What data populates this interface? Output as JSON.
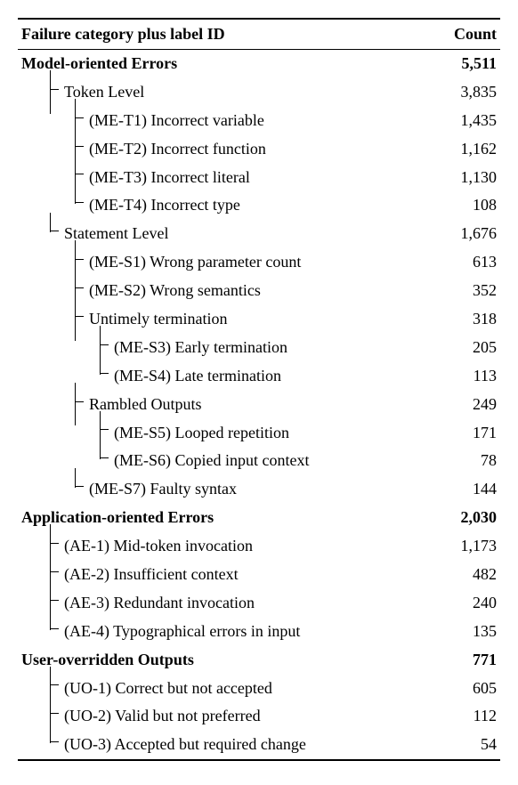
{
  "chart_data": {
    "type": "table",
    "columns": [
      "Failure category plus label ID",
      "Count"
    ],
    "rows": [
      {
        "label": "Model-oriented Errors",
        "count": "5,511",
        "bold": true,
        "indent": 0,
        "tree": null
      },
      {
        "label": "Token Level",
        "count": "3,835",
        "bold": false,
        "indent": 1,
        "tree": "mid"
      },
      {
        "label": "(ME-T1) Incorrect variable",
        "count": "1,435",
        "bold": false,
        "indent": 2,
        "tree": "mid"
      },
      {
        "label": "(ME-T2) Incorrect function",
        "count": "1,162",
        "bold": false,
        "indent": 2,
        "tree": "mid"
      },
      {
        "label": "(ME-T3) Incorrect literal",
        "count": "1,130",
        "bold": false,
        "indent": 2,
        "tree": "mid"
      },
      {
        "label": "(ME-T4) Incorrect type",
        "count": "108",
        "bold": false,
        "indent": 2,
        "tree": "end"
      },
      {
        "label": "Statement Level",
        "count": "1,676",
        "bold": false,
        "indent": 1,
        "tree": "end"
      },
      {
        "label": "(ME-S1) Wrong parameter count",
        "count": "613",
        "bold": false,
        "indent": 2,
        "tree": "mid"
      },
      {
        "label": "(ME-S2) Wrong semantics",
        "count": "352",
        "bold": false,
        "indent": 2,
        "tree": "mid"
      },
      {
        "label": "Untimely termination",
        "count": "318",
        "bold": false,
        "indent": 2,
        "tree": "mid"
      },
      {
        "label": "(ME-S3) Early termination",
        "count": "205",
        "bold": false,
        "indent": 3,
        "tree": "mid"
      },
      {
        "label": "(ME-S4) Late termination",
        "count": "113",
        "bold": false,
        "indent": 3,
        "tree": "end"
      },
      {
        "label": "Rambled Outputs",
        "count": "249",
        "bold": false,
        "indent": 2,
        "tree": "mid"
      },
      {
        "label": "(ME-S5) Looped repetition",
        "count": "171",
        "bold": false,
        "indent": 3,
        "tree": "mid"
      },
      {
        "label": "(ME-S6) Copied input context",
        "count": "78",
        "bold": false,
        "indent": 3,
        "tree": "end"
      },
      {
        "label": "(ME-S7) Faulty syntax",
        "count": "144",
        "bold": false,
        "indent": 2,
        "tree": "end"
      },
      {
        "label": "Application-oriented Errors",
        "count": "2,030",
        "bold": true,
        "indent": 0,
        "tree": null
      },
      {
        "label": "(AE-1) Mid-token invocation",
        "count": "1,173",
        "bold": false,
        "indent": 1,
        "tree": "mid"
      },
      {
        "label": "(AE-2) Insufficient context",
        "count": "482",
        "bold": false,
        "indent": 1,
        "tree": "mid"
      },
      {
        "label": "(AE-3) Redundant invocation",
        "count": "240",
        "bold": false,
        "indent": 1,
        "tree": "mid"
      },
      {
        "label": "(AE-4) Typographical errors in input",
        "count": "135",
        "bold": false,
        "indent": 1,
        "tree": "end"
      },
      {
        "label": "User-overridden Outputs",
        "count": "771",
        "bold": true,
        "indent": 0,
        "tree": null
      },
      {
        "label": "(UO-1) Correct but not accepted",
        "count": "605",
        "bold": false,
        "indent": 1,
        "tree": "mid"
      },
      {
        "label": "(UO-2) Valid but not preferred",
        "count": "112",
        "bold": false,
        "indent": 1,
        "tree": "mid"
      },
      {
        "label": "(UO-3) Accepted but required change",
        "count": "54",
        "bold": false,
        "indent": 1,
        "tree": "end"
      }
    ]
  }
}
